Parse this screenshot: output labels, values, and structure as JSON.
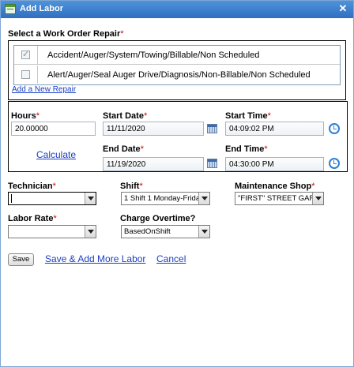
{
  "window": {
    "title": "Add Labor",
    "close_glyph": "✕"
  },
  "repair_section": {
    "label": "Select a Work Order Repair",
    "required_mark": "*",
    "rows": [
      {
        "checked": true,
        "text": "Accident/Auger/System/Towing/Billable/Non Scheduled"
      },
      {
        "checked": false,
        "text": "Alert/Auger/Seal Auger Drive/Diagnosis/Non-Billable/Non Scheduled"
      }
    ],
    "add_link": "Add a New Repair"
  },
  "time": {
    "hours_label": "Hours",
    "hours_value": "20.00000",
    "calculate_link": "Calculate",
    "start_date_label": "Start Date",
    "start_date_value": "11/11/2020",
    "start_time_label": "Start Time",
    "start_time_value": "04:09:02 PM",
    "end_date_label": "End Date",
    "end_date_value": "11/19/2020",
    "end_time_label": "End Time",
    "end_time_value": "04:30:00 PM",
    "required_mark": "*"
  },
  "assignment": {
    "technician_label": "Technician",
    "technician_value": "",
    "shift_label": "Shift",
    "shift_value": "1 Shift 1 Monday-Frida",
    "shop_label": "Maintenance Shop",
    "shop_value": "\"FIRST\" STREET GARAG",
    "labor_rate_label": "Labor Rate",
    "labor_rate_value": "",
    "overtime_label": "Charge Overtime?",
    "overtime_value": "BasedOnShift",
    "required_mark": "*"
  },
  "actions": {
    "save_label": "Save",
    "save_add_more_label": "Save & Add More Labor",
    "cancel_label": "Cancel"
  },
  "icons": {
    "window": "add-labor-icon",
    "calendar": "calendar-icon",
    "clock": "clock-icon",
    "dropdown": "chevron-down-icon"
  },
  "colors": {
    "title_bar": "#3a7fcf",
    "required": "#d40000",
    "link": "#1a3fc4"
  }
}
